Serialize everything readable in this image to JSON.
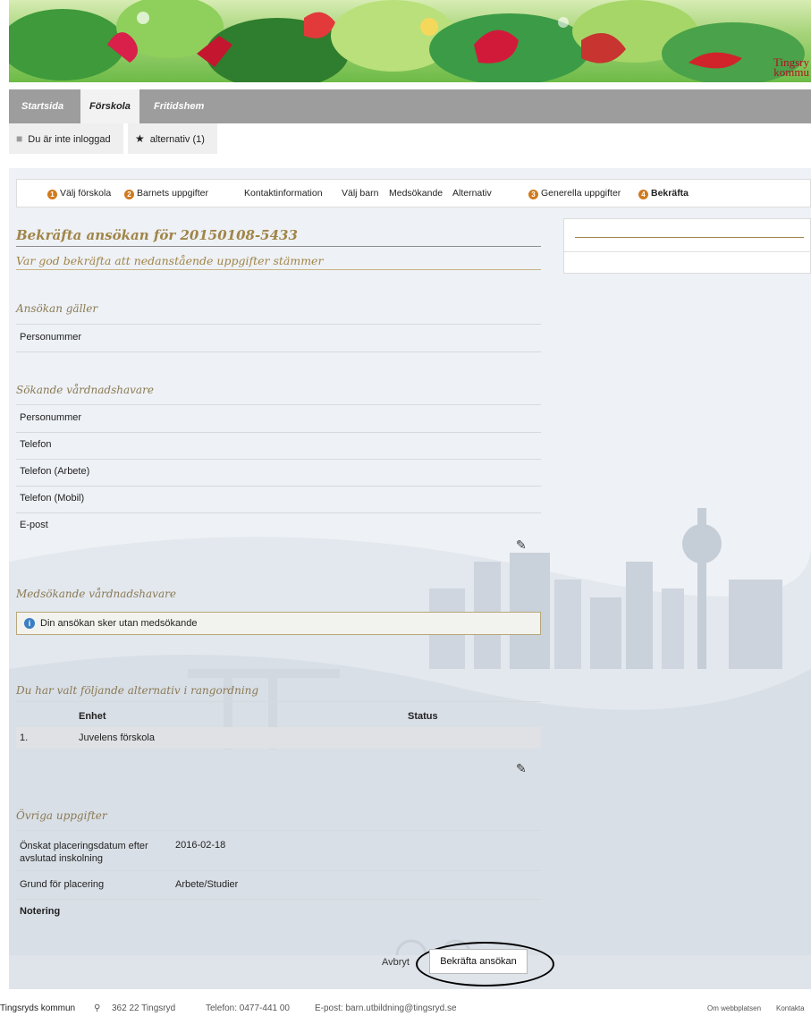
{
  "brand": {
    "line1": "Tingsry",
    "line2": "kommu"
  },
  "tabs": [
    {
      "label": "Startsida",
      "active": false
    },
    {
      "label": "Förskola",
      "active": true
    },
    {
      "label": "Fritidshem",
      "active": false
    }
  ],
  "userbar": {
    "login_status": "Du är inte inloggad",
    "alternatives": "alternativ (1)"
  },
  "steps": [
    {
      "number": "1",
      "label": "Välj förskola"
    },
    {
      "number": "2",
      "label": "Barnets uppgifter"
    },
    {
      "number": "",
      "label": "Kontaktinformation"
    },
    {
      "number": "",
      "label": "Välj barn"
    },
    {
      "number": "",
      "label": "Medsökande"
    },
    {
      "number": "",
      "label": "Alternativ"
    },
    {
      "number": "3",
      "label": "Generella uppgifter"
    },
    {
      "number": "4",
      "label": "Bekräfta",
      "current": true
    }
  ],
  "main": {
    "title": "Bekräfta ansökan för 20150108-5433",
    "subtitle": "Var god bekräfta att nedanstående uppgifter stämmer"
  },
  "application": {
    "heading": "Ansökan gäller",
    "fields": [
      {
        "label": "Personummer",
        "value": ""
      }
    ]
  },
  "guardian": {
    "heading": "Sökande vårdnadshavare",
    "fields": [
      {
        "label": "Personummer",
        "value": ""
      },
      {
        "label": "Telefon",
        "value": ""
      },
      {
        "label": "Telefon (Arbete)",
        "value": ""
      },
      {
        "label": "Telefon (Mobil)",
        "value": ""
      },
      {
        "label": "E-post",
        "value": ""
      }
    ]
  },
  "co_guardian": {
    "heading": "Medsökande vårdnadshavare",
    "info": "Din ansökan sker utan medsökande"
  },
  "alternatives": {
    "heading": "Du har valt följande alternativ i rangordning",
    "col_unit": "Enhet",
    "col_status": "Status",
    "rows": [
      {
        "rank": "1.",
        "unit": "Juvelens förskola",
        "status": ""
      }
    ]
  },
  "other": {
    "heading": "Övriga uppgifter",
    "fields": [
      {
        "label": "Önskat placeringsdatum efter avslutad inskolning",
        "value": "2016-02-18"
      },
      {
        "label": "Grund för placering",
        "value": "Arbete/Studier"
      },
      {
        "label": "Notering",
        "value": ""
      }
    ]
  },
  "actions": {
    "cancel": "Avbryt",
    "confirm": "Bekräfta ansökan"
  },
  "footer": {
    "org": "Tingsryds kommun",
    "address": "362 22 Tingsryd",
    "phone": "Telefon: 0477-441 00",
    "email": "E-post: barn.utbildning@tingsryd.se",
    "link_about": "Om webbplatsen",
    "link_contact": "Kontakta"
  },
  "colors": {
    "accent": "#a08548",
    "step_badge": "#d07a1e",
    "tabbar": "#9d9d9d"
  }
}
